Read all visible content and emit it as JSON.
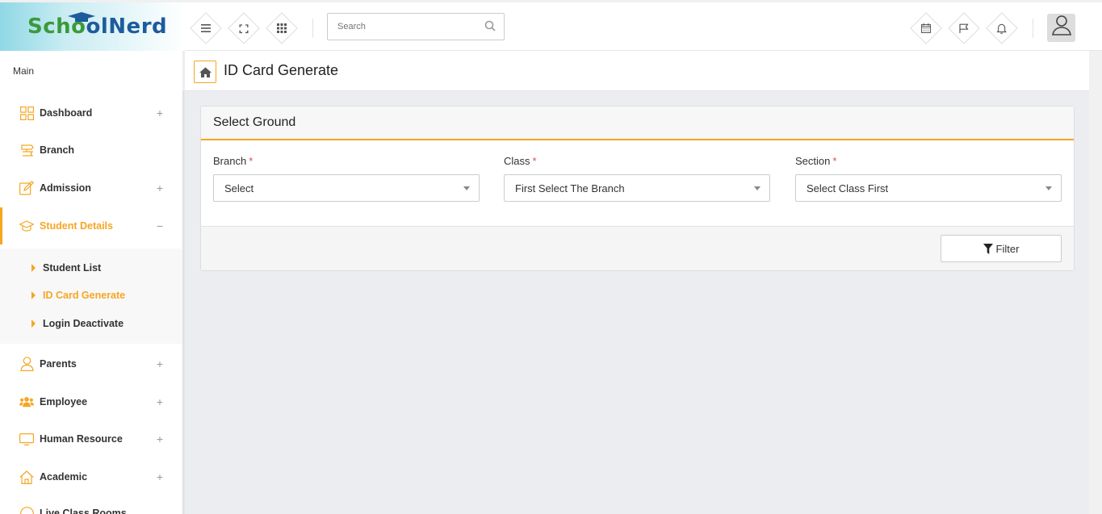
{
  "brand": {
    "part1": "Scho",
    "part2": "ol",
    "part3": "Nerd"
  },
  "topbar": {
    "search_placeholder": "Search",
    "left_icons": [
      "menu-icon",
      "fullscreen-icon",
      "grid-icon"
    ],
    "right_icons": [
      "calendar-icon",
      "flag-icon",
      "bell-icon"
    ]
  },
  "sidebar": {
    "heading": "Main",
    "items": [
      {
        "label": "Dashboard",
        "icon": "dashboard-icon",
        "toggle": "+"
      },
      {
        "label": "Branch",
        "icon": "branch-icon",
        "toggle": ""
      },
      {
        "label": "Admission",
        "icon": "admission-icon",
        "toggle": "+"
      },
      {
        "label": "Student Details",
        "icon": "graduation-cap-icon",
        "toggle": "−"
      },
      {
        "label": "Parents",
        "icon": "parent-icon",
        "toggle": "+"
      },
      {
        "label": "Employee",
        "icon": "users-icon",
        "toggle": "+"
      },
      {
        "label": "Human Resource",
        "icon": "monitor-icon",
        "toggle": "+"
      },
      {
        "label": "Academic",
        "icon": "home-icon",
        "toggle": "+"
      },
      {
        "label": "Live Class Rooms",
        "icon": "clock-icon",
        "toggle": ""
      }
    ],
    "submenu": [
      {
        "label": "Student List"
      },
      {
        "label": "ID Card Generate"
      },
      {
        "label": "Login Deactivate"
      }
    ]
  },
  "page": {
    "title": "ID Card Generate"
  },
  "card": {
    "title": "Select Ground",
    "fields": [
      {
        "label": "Branch",
        "required": "*",
        "value": "Select"
      },
      {
        "label": "Class",
        "required": "*",
        "value": "First Select The Branch"
      },
      {
        "label": "Section",
        "required": "*",
        "value": "Select Class First"
      }
    ],
    "filter_label": "Filter"
  },
  "colors": {
    "accent": "#f5a623",
    "logo_green": "#3a9a3a",
    "logo_blue": "#1d5c9c"
  }
}
